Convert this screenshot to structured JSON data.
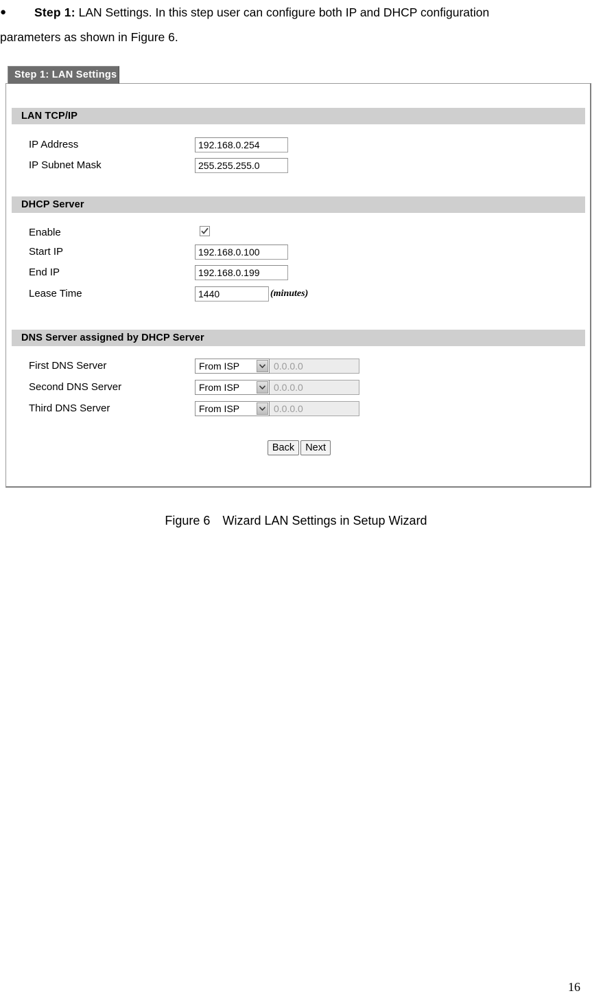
{
  "document": {
    "bullet": "●",
    "step_label": "Step 1:",
    "paragraph_line1": "LAN Settings. In this  step user can  configure both IP  and DHCP  configuration",
    "paragraph_line2": "parameters as shown in Figure 6.",
    "figure_caption_number": "Figure 6",
    "figure_caption_text": "Wizard LAN Settings in Setup Wizard",
    "page_number": "16"
  },
  "screenshot": {
    "tab_title": "Step 1: LAN Settings",
    "sections": {
      "lan_tcpip": {
        "title": "LAN TCP/IP",
        "rows": [
          {
            "label": "IP Address",
            "value": "192.168.0.254"
          },
          {
            "label": "IP Subnet Mask",
            "value": "255.255.255.0"
          }
        ]
      },
      "dhcp_server": {
        "title": "DHCP Server",
        "enable_label": "Enable",
        "enable_checked": true,
        "rows": [
          {
            "label": "Start IP",
            "value": "192.168.0.100"
          },
          {
            "label": "End IP",
            "value": "192.168.0.199"
          },
          {
            "label": "Lease Time",
            "value": "1440",
            "unit": "(minutes)"
          }
        ]
      },
      "dns_server": {
        "title": "DNS Server assigned by DHCP Server",
        "rows": [
          {
            "label": "First DNS Server",
            "source": "From ISP",
            "address": "0.0.0.0"
          },
          {
            "label": "Second DNS Server",
            "source": "From ISP",
            "address": "0.0.0.0"
          },
          {
            "label": "Third DNS Server",
            "source": "From ISP",
            "address": "0.0.0.0"
          }
        ]
      }
    },
    "buttons": {
      "back": "Back",
      "next": "Next"
    },
    "colors": {
      "tab_background": "#6d6d6d",
      "section_bar": "#cfcfcf",
      "panel_border": "#9a9a9a",
      "disabled_field": "#ececec",
      "disabled_text": "#9b9b9b"
    }
  }
}
